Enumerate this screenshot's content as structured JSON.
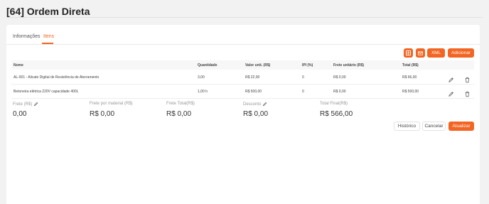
{
  "page": {
    "title": "[64] Ordem Direta"
  },
  "tabs": [
    {
      "label": "Informações",
      "active": false
    },
    {
      "label": "Itens",
      "active": true
    }
  ],
  "toolbar": {
    "xml_label": "XML",
    "add_label": "Adicionar"
  },
  "table": {
    "headers": {
      "nome": "Nome",
      "quantidade": "Quantidade",
      "valor_unit": "Valor unit. (R$)",
      "ipi": "IPI (%)",
      "frete_unit": "Frete unitário (R$)",
      "total": "Total (R$)"
    },
    "rows": [
      {
        "nome": "AL-001 - Alicate Digital de Resistência de Aterramento",
        "quantidade": "3,00",
        "valor_unit": "R$ 22,00",
        "ipi": "0",
        "frete_unit": "R$ 0,00",
        "total": "R$ 66,00"
      },
      {
        "nome": "Betoneira elétrica 220V capacidade 400L",
        "quantidade": "1,00 h",
        "valor_unit": "R$ 500,00",
        "ipi": "0",
        "frete_unit": "R$ 0,00",
        "total": "R$ 500,00"
      }
    ]
  },
  "summary": {
    "frete": {
      "label": "Frete (R$)",
      "value": "0,00"
    },
    "frete_material": {
      "label": "Frete por material (R$)",
      "value": "R$ 0,00"
    },
    "frete_total": {
      "label": "Frete Total(R$)",
      "value": "R$ 0,00"
    },
    "desconto": {
      "label": "Desconto",
      "value": "R$ 0,00"
    },
    "total_final": {
      "label": "Total Final(R$)",
      "value": "R$ 566,00"
    }
  },
  "actions": {
    "historico": "Histórico",
    "cancelar": "Cancelar",
    "atualizar": "Atualizar"
  },
  "colors": {
    "accent": "#f26522"
  },
  "icons": [
    "grid-icon",
    "mail-icon",
    "pencil-icon",
    "trash-icon"
  ]
}
